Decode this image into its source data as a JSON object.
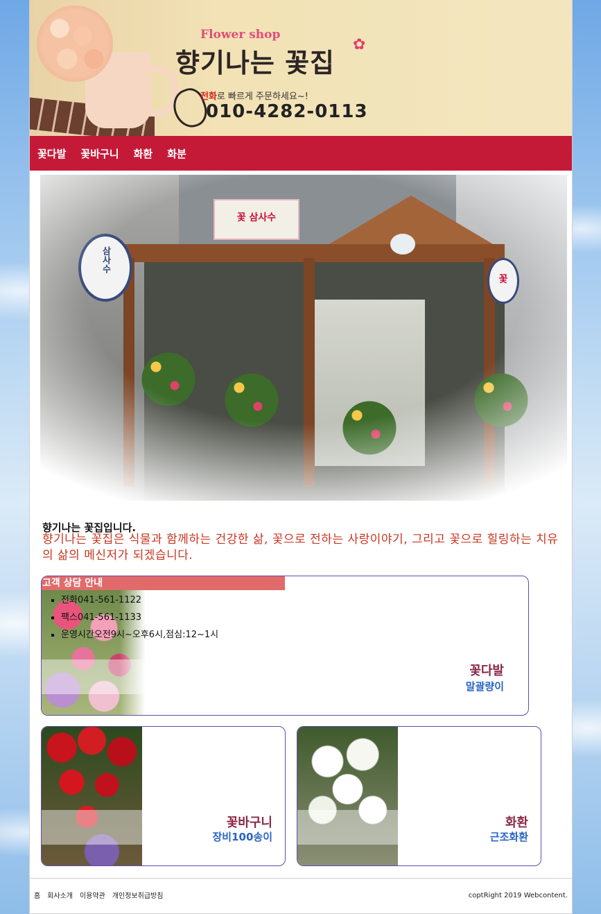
{
  "header": {
    "flower_shop": "Flower shop",
    "brand": "향기나는 꽃집",
    "call_prefix": "전화",
    "call_suffix": "로 빠르게 주문하세요~!",
    "phone": "010-4282-0113"
  },
  "nav": {
    "items": [
      {
        "label": "꽃다발"
      },
      {
        "label": "꽃바구니"
      },
      {
        "label": "화환"
      },
      {
        "label": "화분"
      }
    ]
  },
  "hero": {
    "shop_sign": "꽃 삼사수",
    "round_sign": "삼사수",
    "round_sign2": "꽃"
  },
  "intro": {
    "title": "향기나는 꽃집입니다.",
    "text": "향기나는 꽃집은 식물과 함께하는 건강한 삶, 꽃으로 전하는 사랑이야기, 그리고 꽃으로 힐링하는 치유 의 삶의 메신저가 되겠습니다."
  },
  "info": {
    "heading": "고객 상담 안내",
    "items": [
      "전화041-561-1122",
      "팩스041-561-1133",
      "운영시간오전9시~오후6시,점심:12~1시"
    ]
  },
  "cards": [
    {
      "title": "꽃다발",
      "subtitle": "말괄량이"
    },
    {
      "title": "꽃바구니",
      "subtitle": "장비100송이"
    },
    {
      "title": "화환",
      "subtitle": "근조화환"
    }
  ],
  "footer": {
    "links": [
      "홈",
      "회사소개",
      "이용약관",
      "개인정보취급방침"
    ],
    "copyright": "coptRight 2019 Webcontent."
  },
  "colors": {
    "nav_bg": "#c41a38",
    "accent_red_text": "#c8351f",
    "card_title": "#8a2846",
    "card_subtitle": "#2a64c2",
    "info_head_bg": "#e16a6a"
  }
}
